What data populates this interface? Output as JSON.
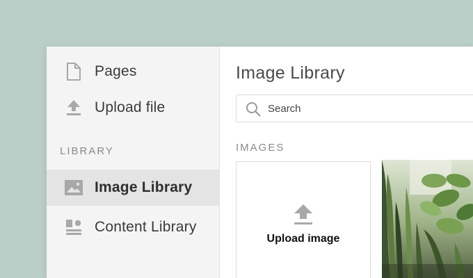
{
  "sidebar": {
    "items": [
      {
        "label": "Pages",
        "icon": "page-icon"
      },
      {
        "label": "Upload file",
        "icon": "upload-icon"
      }
    ],
    "section_label": "LIBRARY",
    "library_items": [
      {
        "label": "Image Library",
        "icon": "image-icon",
        "active": true
      },
      {
        "label": "Content Library",
        "icon": "content-blocks-icon",
        "active": false
      }
    ]
  },
  "main": {
    "title": "Image Library",
    "search": {
      "placeholder": "Search",
      "value": "",
      "icon": "search-icon"
    },
    "images_label": "IMAGES",
    "upload_card": {
      "label": "Upload image",
      "icon": "upload-icon"
    },
    "photo": {
      "subject": "plant-photo"
    }
  },
  "colors": {
    "background": "#b9cfc7",
    "sidebar": "#f4f4f4",
    "active_item": "#e4e4e4",
    "icon_gray": "#a8a8a8"
  }
}
